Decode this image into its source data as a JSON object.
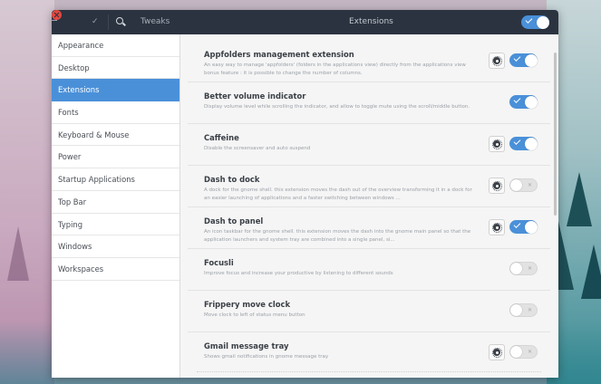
{
  "window": {
    "app_title": "Tweaks",
    "pane_title": "Extensions",
    "master_toggle_on": true
  },
  "titlebar_icons": [
    "close-icon",
    "minimize-icon",
    "maximize-icon",
    "search-icon"
  ],
  "sidebar": {
    "selected": "Extensions",
    "items": [
      {
        "label": "Appearance"
      },
      {
        "label": "Desktop"
      },
      {
        "label": "Extensions"
      },
      {
        "label": "Fonts"
      },
      {
        "label": "Keyboard & Mouse"
      },
      {
        "label": "Power"
      },
      {
        "label": "Startup Applications"
      },
      {
        "label": "Top Bar"
      },
      {
        "label": "Typing"
      },
      {
        "label": "Windows"
      },
      {
        "label": "Workspaces"
      }
    ]
  },
  "extensions": [
    {
      "name": "Appfolders management extension",
      "description": "An easy way to manage 'appfolders' (folders in the applications view) directly from the applications view bonus feature : it is possible to change the number of columns.",
      "has_settings": true,
      "enabled": true
    },
    {
      "name": "Better volume indicator",
      "description": "Display volume level while scrolling the indicator, and allow to toggle mute using the scroll/middle button.",
      "has_settings": false,
      "enabled": true
    },
    {
      "name": "Caffeine",
      "description": "Disable the screensaver and auto suspend",
      "has_settings": true,
      "enabled": true
    },
    {
      "name": "Dash to dock",
      "description": "A dock for the gnome shell. this extension moves the dash out of the overview transforming it in a dock for an easier launching of applications and a faster switching between windows ...",
      "has_settings": true,
      "enabled": false
    },
    {
      "name": "Dash to panel",
      "description": "An icon taskbar for the gnome shell. this extension moves the dash into the gnome main panel so that the application launchers and system tray are combined into a single panel, si...",
      "has_settings": true,
      "enabled": true
    },
    {
      "name": "Focusli",
      "description": "Improve focus and increase your productive by listening to different sounds",
      "has_settings": false,
      "enabled": false
    },
    {
      "name": "Frippery move clock",
      "description": "Move clock to left of status menu button",
      "has_settings": false,
      "enabled": false
    },
    {
      "name": "Gmail message tray",
      "description": "Shows gmail notifications in gnome message tray",
      "has_settings": true,
      "enabled": false
    }
  ],
  "colors": {
    "titlebar": "#2b3340",
    "accent": "#4a90d9",
    "close": "#e3473f",
    "sidebar_selected_text": "#ffffff"
  }
}
